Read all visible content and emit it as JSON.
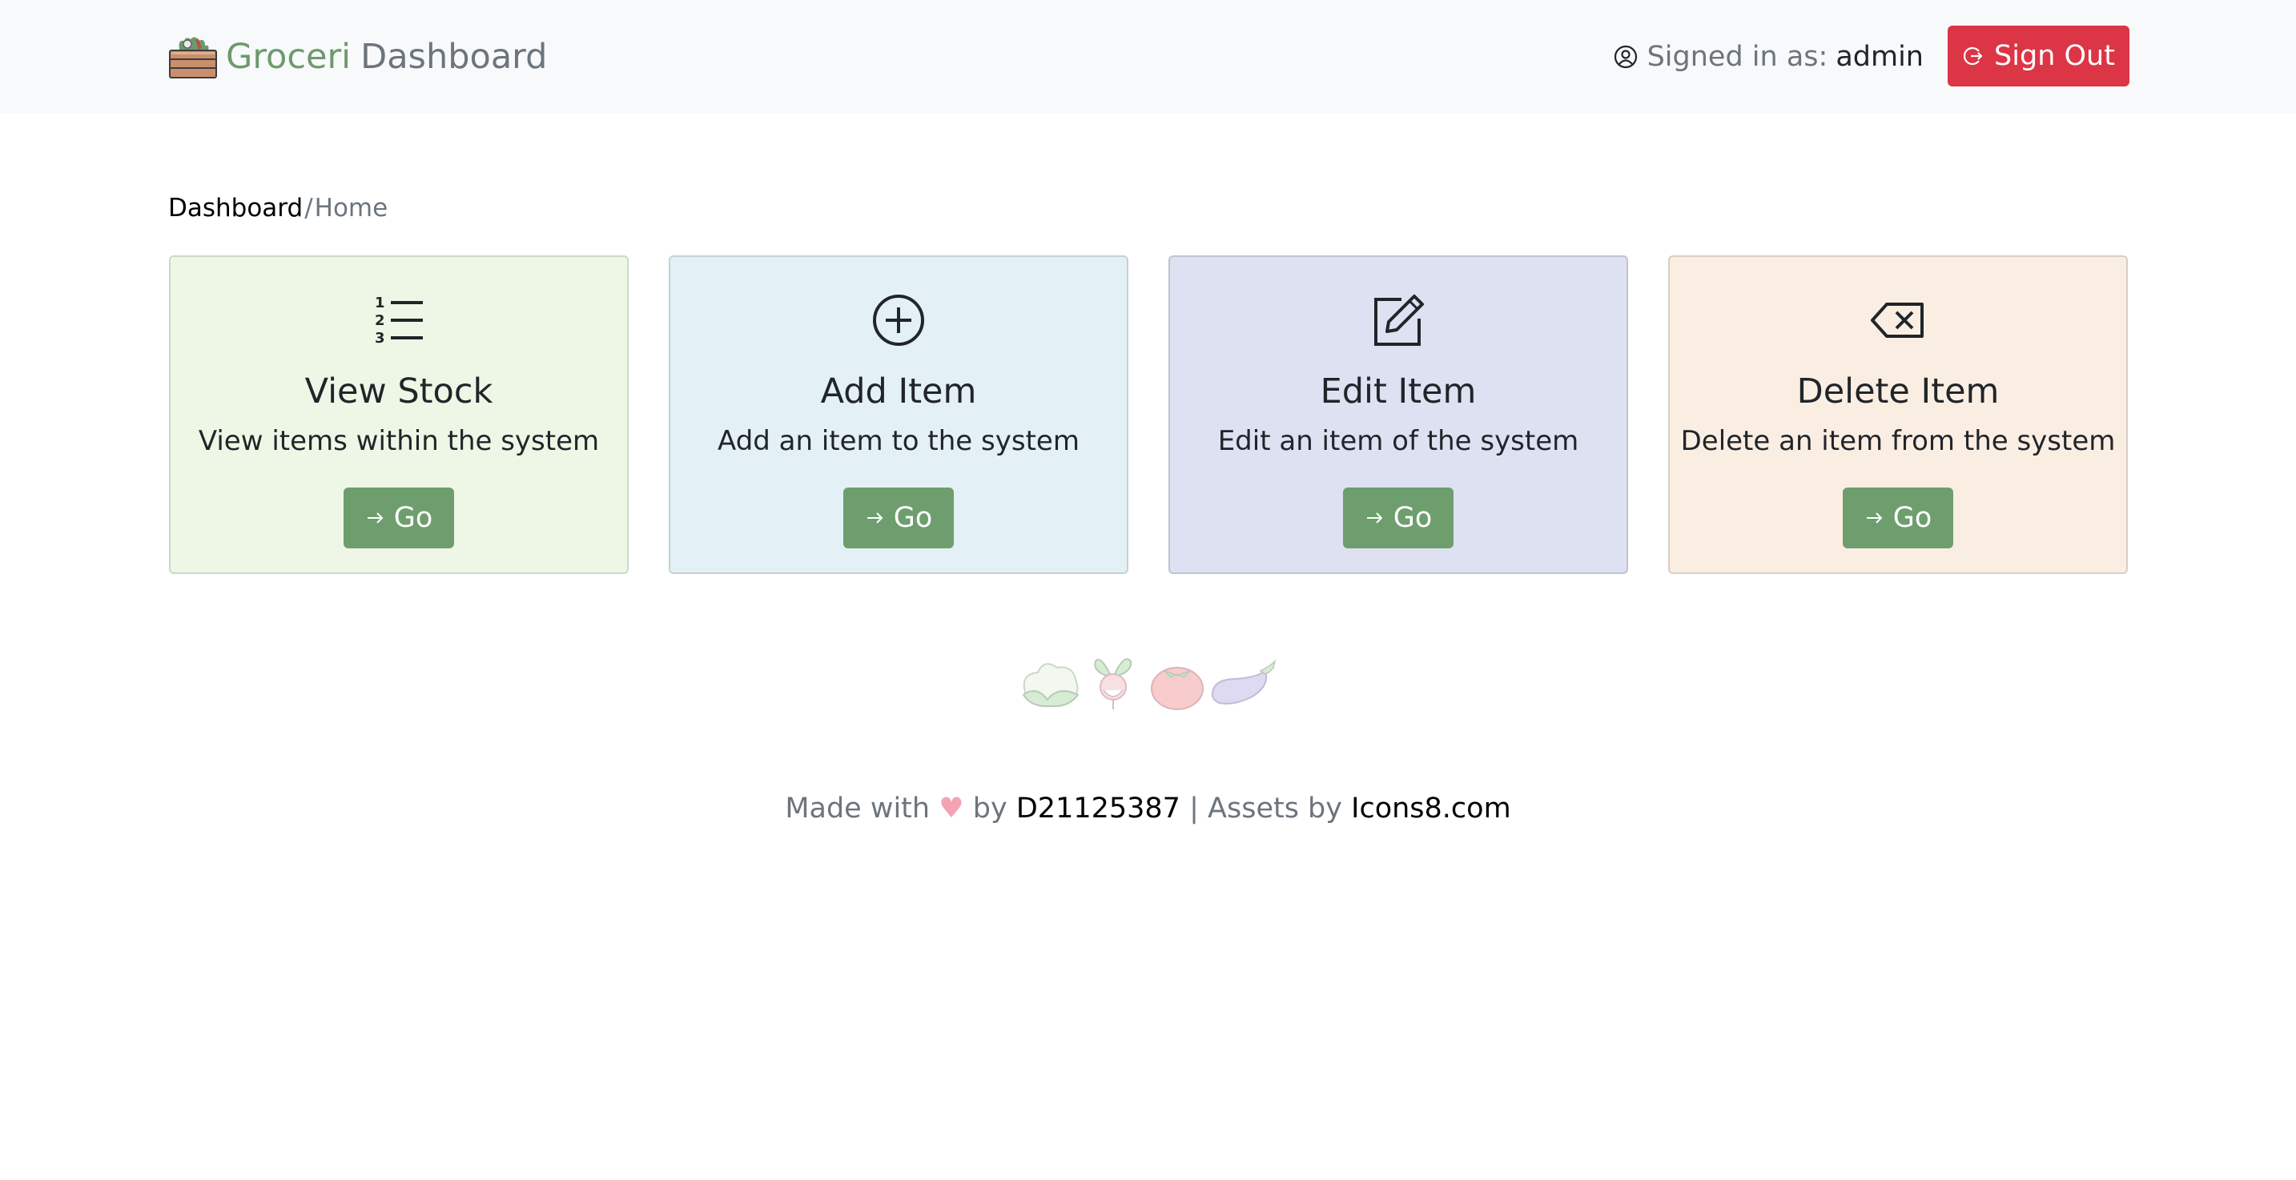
{
  "header": {
    "brand_primary": "Groceri",
    "brand_secondary": "Dashboard",
    "signed_in_label": "Signed in as:",
    "username": "admin",
    "sign_out_label": "Sign Out"
  },
  "breadcrumb": {
    "active": "Dashboard",
    "separator": "/",
    "current": "Home"
  },
  "cards": [
    {
      "icon": "numbered-list-icon",
      "title": "View Stock",
      "text": "View items within the system",
      "button": "Go",
      "bg": "#eef7e6"
    },
    {
      "icon": "plus-circle-icon",
      "title": "Add Item",
      "text": "Add an item to the system",
      "button": "Go",
      "bg": "#e3f0f5"
    },
    {
      "icon": "pencil-square-icon",
      "title": "Edit Item",
      "text": "Edit an item of the system",
      "button": "Go",
      "bg": "#dee1f1"
    },
    {
      "icon": "backspace-icon",
      "title": "Delete Item",
      "text": "Delete an item from the system",
      "button": "Go",
      "bg": "#faeee3"
    }
  ],
  "footer": {
    "made_with": "Made with",
    "heart": "♥",
    "by": "by",
    "author": "D21125387",
    "divider": "|",
    "assets_by": "Assets by",
    "assets_link": "Icons8.com"
  },
  "colors": {
    "brand_green": "#6c9a6c",
    "go_button": "#6e9e6e",
    "sign_out": "#dc3545",
    "navbar_bg": "#f8f9fa"
  }
}
